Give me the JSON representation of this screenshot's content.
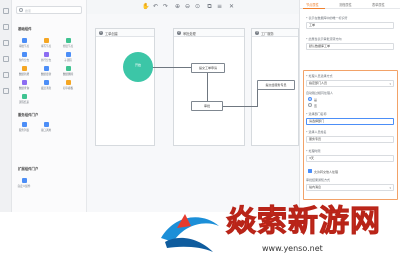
{
  "panel": {
    "search_placeholder": "搜索",
    "sections": [
      {
        "title": "基础组件",
        "items": [
          "审批节点",
          "填写节点",
          "抄送节点",
          "条件分支",
          "并行分支",
          "子流程",
          "数据新增",
          "数据更新",
          "数据删除",
          "数据查询",
          "发送消息",
          "打印模板",
          "流程结束"
        ]
      },
      {
        "title": "服务组件门户",
        "items": [
          "服务列表",
          "接口调用"
        ]
      },
      {
        "title": "扩展组件门户",
        "items": [
          "自定义组件"
        ]
      }
    ]
  },
  "canvas": {
    "lanes": [
      {
        "num": "1",
        "title": "工单创建"
      },
      {
        "num": "2",
        "title": "审批处理"
      },
      {
        "num": "3",
        "title": "工厂服务"
      }
    ],
    "start_label": "开始",
    "tasks": [
      "提交工单申请",
      "审批",
      "提交给服务专员"
    ]
  },
  "props": {
    "tabs": [
      "节点属性",
      "流程属性",
      "表单属性"
    ],
    "rows": [
      {
        "label": "* 表示在数据库中的唯一标识符",
        "value": "工单"
      },
      {
        "label": "* 此属性表示审批流转方向",
        "value": "默认数据库工单"
      },
      {
        "label": "* 处理人员选择方式",
        "value": "指定部门人员"
      },
      {
        "label": "* 选择部门名称",
        "value": "请选择部门"
      },
      {
        "label": "* 选择人员姓名",
        "value": "服务专员"
      },
      {
        "label": "* 处理时限",
        "value": "3天"
      }
    ],
    "radio_title": "自动跳过相同处理人",
    "radio_options": [
      "是",
      "否"
    ],
    "check_label": "允许转交他人处理",
    "bottom_label": "审批结果通知方式",
    "bottom_value": "站内消息"
  },
  "watermark": {
    "text": "焱索新游网",
    "url": "www.yenso.net"
  },
  "colors": {
    "accent": "#f0812e",
    "start_node": "#3cc6a7",
    "watermark_red": "#e63b2e"
  }
}
